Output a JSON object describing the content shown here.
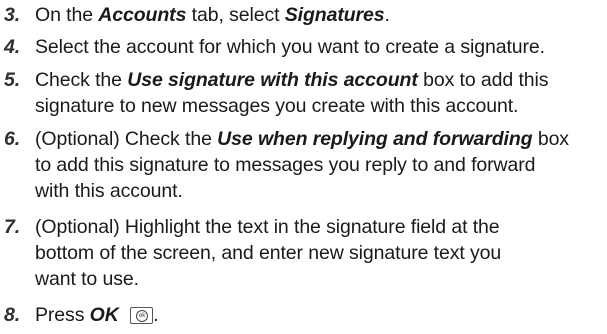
{
  "steps": [
    {
      "number": "3.",
      "lines": [
        [
          {
            "t": "On the ",
            "em": false
          },
          {
            "t": "Accounts",
            "em": true
          },
          {
            "t": " tab, select ",
            "em": false
          },
          {
            "t": "Signatures",
            "em": true
          },
          {
            "t": ".",
            "em": false
          }
        ]
      ]
    },
    {
      "number": "4.",
      "lines": [
        [
          {
            "t": "Select the account for which you want to create a signature.",
            "em": false
          }
        ]
      ]
    },
    {
      "number": "5.",
      "lines": [
        [
          {
            "t": "Check the ",
            "em": false
          },
          {
            "t": "Use signature with this account",
            "em": true
          },
          {
            "t": " box to add this",
            "em": false
          }
        ],
        [
          {
            "t": "signature to new messages you create with this account.",
            "em": false
          }
        ]
      ]
    },
    {
      "number": "6.",
      "lines": [
        [
          {
            "t": "(Optional) Check the ",
            "em": false
          },
          {
            "t": "Use when replying and forwarding",
            "em": true
          },
          {
            "t": " box",
            "em": false
          }
        ],
        [
          {
            "t": "to add this signature to messages you reply to and forward",
            "em": false
          }
        ],
        [
          {
            "t": "with this account.",
            "em": false
          }
        ]
      ]
    },
    {
      "number": "7.",
      "lines": [
        [
          {
            "t": "(Optional) Highlight the text in the signature field at the",
            "em": false
          }
        ],
        [
          {
            "t": "bottom of the screen, and enter new signature text you",
            "em": false
          }
        ],
        [
          {
            "t": "want to use.",
            "em": false
          }
        ]
      ]
    },
    {
      "number": "8.",
      "lines": [
        [
          {
            "t": "Press ",
            "em": false
          },
          {
            "t": "OK",
            "em": true
          },
          {
            "t": " ",
            "em": false
          }
        ]
      ],
      "trailing_key": {
        "icon": "ok-key-icon",
        "label": "ok"
      }
    }
  ]
}
